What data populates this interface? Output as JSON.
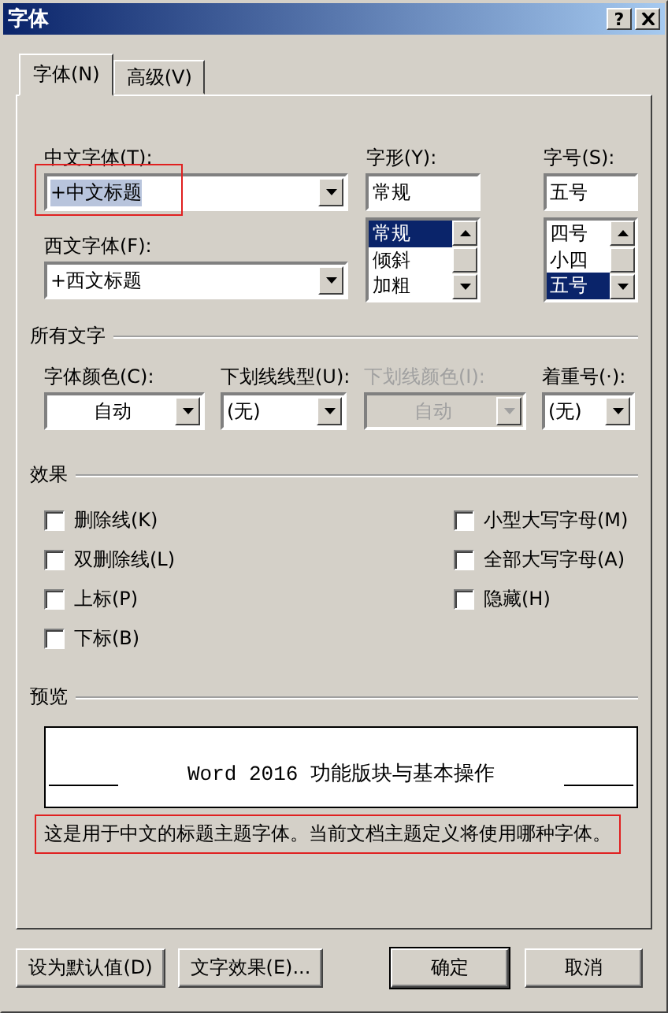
{
  "window": {
    "title": "字体",
    "help_button": "?"
  },
  "tabs": [
    {
      "label": "字体(N)",
      "selected": true
    },
    {
      "label": "高级(V)",
      "selected": false
    }
  ],
  "chinese_font": {
    "label": "中文字体(T):",
    "value": "+中文标题",
    "highlighted": true
  },
  "western_font": {
    "label": "西文字体(F):",
    "value": "+西文标题",
    "highlighted": false
  },
  "font_style": {
    "label": "字形(Y):",
    "value": "常规",
    "options": [
      {
        "label": "常规",
        "selected": true
      },
      {
        "label": "倾斜",
        "selected": false
      },
      {
        "label": "加粗",
        "selected": false
      }
    ]
  },
  "font_size": {
    "label": "字号(S):",
    "value": "五号",
    "options": [
      {
        "label": "四号",
        "selected": false
      },
      {
        "label": "小四",
        "selected": false
      },
      {
        "label": "五号",
        "selected": true
      }
    ]
  },
  "all_text": {
    "title": "所有文字",
    "dropdowns": [
      {
        "label": "字体颜色(C):",
        "value": "自动",
        "kind": "color",
        "disabled": false
      },
      {
        "label": "下划线线型(U):",
        "value": "(无)",
        "kind": "list",
        "disabled": false
      },
      {
        "label": "下划线颜色(I):",
        "value": "自动",
        "kind": "color",
        "disabled": true
      },
      {
        "label": "着重号(·):",
        "value": "(无)",
        "kind": "list",
        "disabled": false
      }
    ]
  },
  "effects": {
    "title": "效果",
    "left": [
      {
        "label": "删除线(K)",
        "checked": false
      },
      {
        "label": "双删除线(L)",
        "checked": false
      },
      {
        "label": "上标(P)",
        "checked": false
      },
      {
        "label": "下标(B)",
        "checked": false
      }
    ],
    "right": [
      {
        "label": "小型大写字母(M)",
        "checked": false
      },
      {
        "label": "全部大写字母(A)",
        "checked": false
      },
      {
        "label": "隐藏(H)",
        "checked": false
      }
    ]
  },
  "preview": {
    "title": "预览",
    "sample": "Word 2016 功能版块与基本操作",
    "description": "这是用于中文的标题主题字体。当前文档主题定义将使用哪种字体。",
    "highlighted": true
  },
  "buttons": [
    {
      "label": "设为默认值(D)",
      "kind": "normal"
    },
    {
      "label": "文字效果(E)...",
      "kind": "normal"
    },
    {
      "label": "确定",
      "kind": "default"
    },
    {
      "label": "取消",
      "kind": "normal"
    }
  ]
}
